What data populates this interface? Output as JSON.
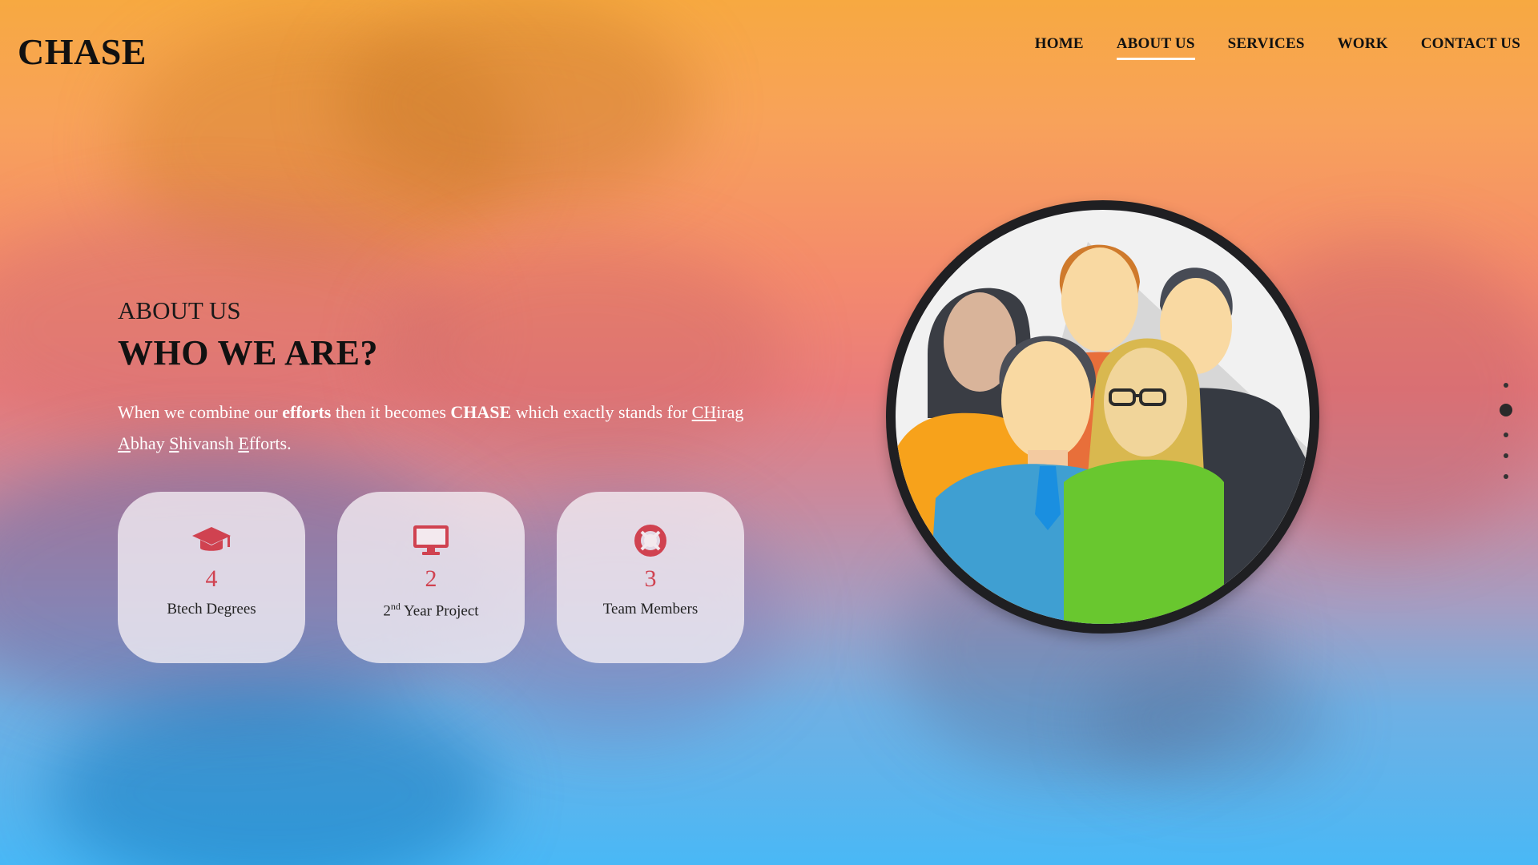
{
  "brand": {
    "logo": "CHASE"
  },
  "nav": {
    "items": [
      "HOME",
      "ABOUT US",
      "SERVICES",
      "WORK",
      "CONTACT US"
    ],
    "active": "ABOUT US"
  },
  "about": {
    "subtitle": "ABOUT US",
    "title": "WHO WE ARE?",
    "text_1": "When we combine our ",
    "bold_1": "efforts",
    "text_2": " then it becomes ",
    "bold_2": "CHASE",
    "text_3": " which exactly stands for ",
    "ul_1": "CH",
    "text_4": "irag ",
    "ul_2": "A",
    "text_5": "bhay ",
    "ul_3": "S",
    "text_6": "hivansh ",
    "ul_4": "E",
    "text_7": "fforts."
  },
  "stats": [
    {
      "icon": "graduation-cap-icon",
      "value": "4",
      "label": "Btech Degrees"
    },
    {
      "icon": "desktop-icon",
      "value": "2",
      "label_pre": "2",
      "label_sup": "nd",
      "label_post": " Year Project"
    },
    {
      "icon": "life-ring-icon",
      "value": "3",
      "label": "Team Members"
    }
  ],
  "team_image": {
    "icon": "team-illustration"
  },
  "pagination": {
    "count": 5,
    "active_index": 1
  },
  "colors": {
    "accent": "#d04250",
    "text_dark": "#111111",
    "text_light": "#ffffff"
  }
}
